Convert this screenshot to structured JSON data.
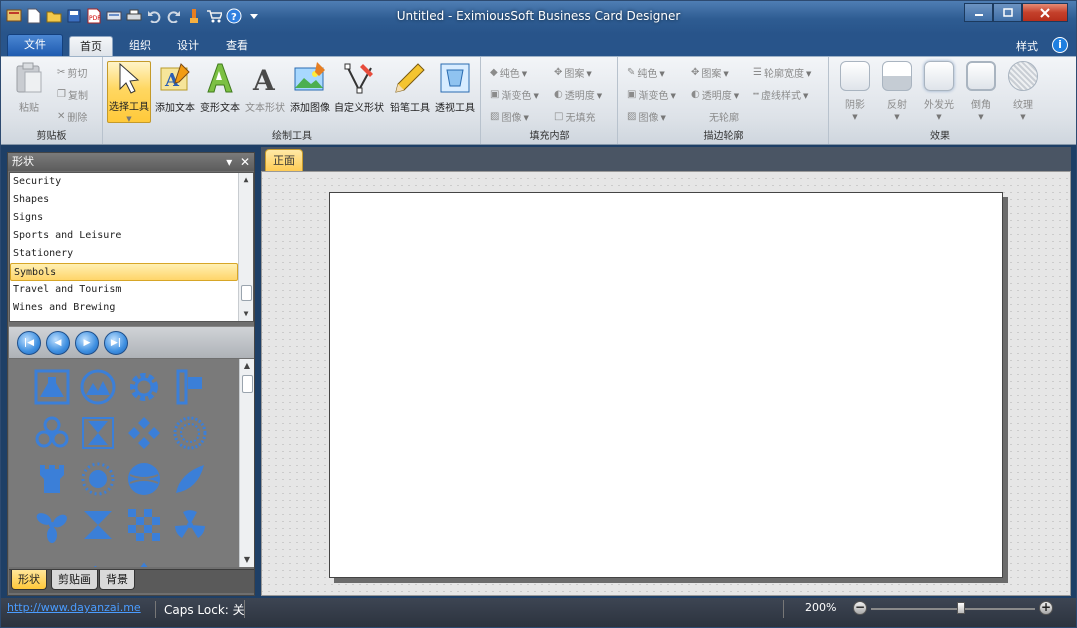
{
  "window": {
    "title": "Untitled - EximiousSoft Business Card Designer",
    "controls": [
      "minimize",
      "maximize",
      "close"
    ]
  },
  "quick_access": [
    "app-menu-icon",
    "new-icon",
    "open-icon",
    "save-icon",
    "pdf-icon",
    "scan-icon",
    "print-icon",
    "undo-icon",
    "redo-icon",
    "paint-icon",
    "cart-icon",
    "help-icon",
    "dropdown-icon"
  ],
  "ribbon_tabs": {
    "file": "文件",
    "tabs": [
      "首页",
      "组织",
      "设计",
      "查看"
    ],
    "active": "首页",
    "style_label": "样式"
  },
  "clipboard": {
    "paste": "粘贴",
    "cut": "剪切",
    "copy": "复制",
    "delete": "删除",
    "group_label": "剪贴板"
  },
  "draw_tools": {
    "select": "选择工具",
    "add_text": "添加文本",
    "warp_text": "变形文本",
    "text_shape": "文本形状",
    "add_image": "添加图像",
    "custom_shape": "自定义形状",
    "pencil": "铅笔工具",
    "perspective": "透视工具",
    "group_label": "绘制工具"
  },
  "fill": {
    "solid": "纯色",
    "pattern": "图案",
    "gradient": "渐变色",
    "transparency": "透明度",
    "image": "图像",
    "no_fill": "无填充",
    "group_label": "填充内部"
  },
  "outline": {
    "solid": "纯色",
    "pattern": "图案",
    "width": "轮廓宽度",
    "gradient": "渐变色",
    "transparency": "透明度",
    "style": "虚线样式",
    "image": "图像",
    "no_outline": "无轮廓",
    "group_label": "描边轮廓"
  },
  "effects": {
    "items": [
      "阴影",
      "反射",
      "外发光",
      "倒角",
      "纹理"
    ],
    "group_label": "效果"
  },
  "panel": {
    "title": "形状",
    "categories": [
      "Security",
      "Shapes",
      "Signs",
      "Sports and Leisure",
      "Stationery",
      "Symbols",
      "Travel and Tourism",
      "Wines and Brewing"
    ],
    "selected_category": "Symbols",
    "tabs": [
      "形状",
      "剪贴画",
      "背景"
    ],
    "active_tab": "形状"
  },
  "document": {
    "tab": "正面"
  },
  "status": {
    "url": "http://www.dayanzai.me",
    "caps_lock": "Caps Lock: 关",
    "zoom": "200%"
  },
  "colors": {
    "accent": "#ffc83a",
    "shape_blue": "#3b7fd8",
    "title_bar": "#2e5c92"
  }
}
